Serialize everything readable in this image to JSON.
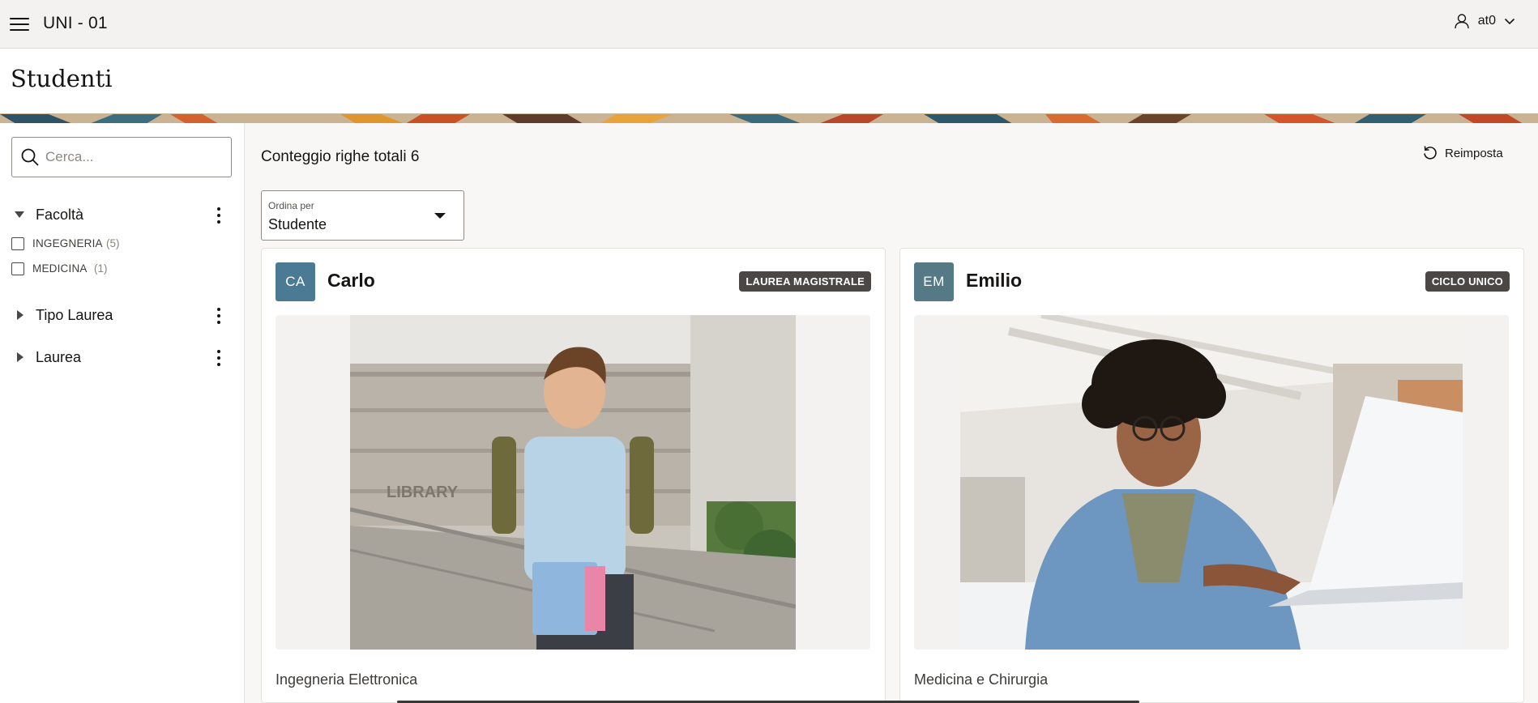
{
  "header": {
    "app_title": "UNI - 01",
    "user_name": "at0"
  },
  "page": {
    "title": "Studenti"
  },
  "search": {
    "placeholder": "Cerca..."
  },
  "facets": [
    {
      "label": "Facoltà",
      "expanded": true,
      "options": [
        {
          "label": "INGEGNERIA",
          "count": "(5)",
          "checked": false
        },
        {
          "label": "MEDICINA",
          "count": "(1)",
          "checked": false
        }
      ]
    },
    {
      "label": "Tipo Laurea",
      "expanded": false
    },
    {
      "label": "Laurea",
      "expanded": false
    }
  ],
  "results": {
    "row_count_text": "Conteggio righe totali 6",
    "reset_label": "Reimposta",
    "sort_label": "Ordina per",
    "sort_value": "Studente"
  },
  "cards": [
    {
      "initials": "CA",
      "avatar_color": "#4a7a94",
      "name": "Carlo",
      "badge": "LAUREA MAGISTRALE",
      "subtitle": "Ingegneria Elettronica",
      "photo_description_icon": "student-with-backpack-photo"
    },
    {
      "initials": "EM",
      "avatar_color": "#557a85",
      "name": "Emilio",
      "badge": "CICLO UNICO",
      "subtitle": "Medicina e Chirurgia",
      "photo_description_icon": "student-with-laptop-photo"
    }
  ],
  "colors": {
    "header_bg": "#f3f2f0",
    "badge_bg": "#4a4744",
    "accent": "#161513"
  }
}
